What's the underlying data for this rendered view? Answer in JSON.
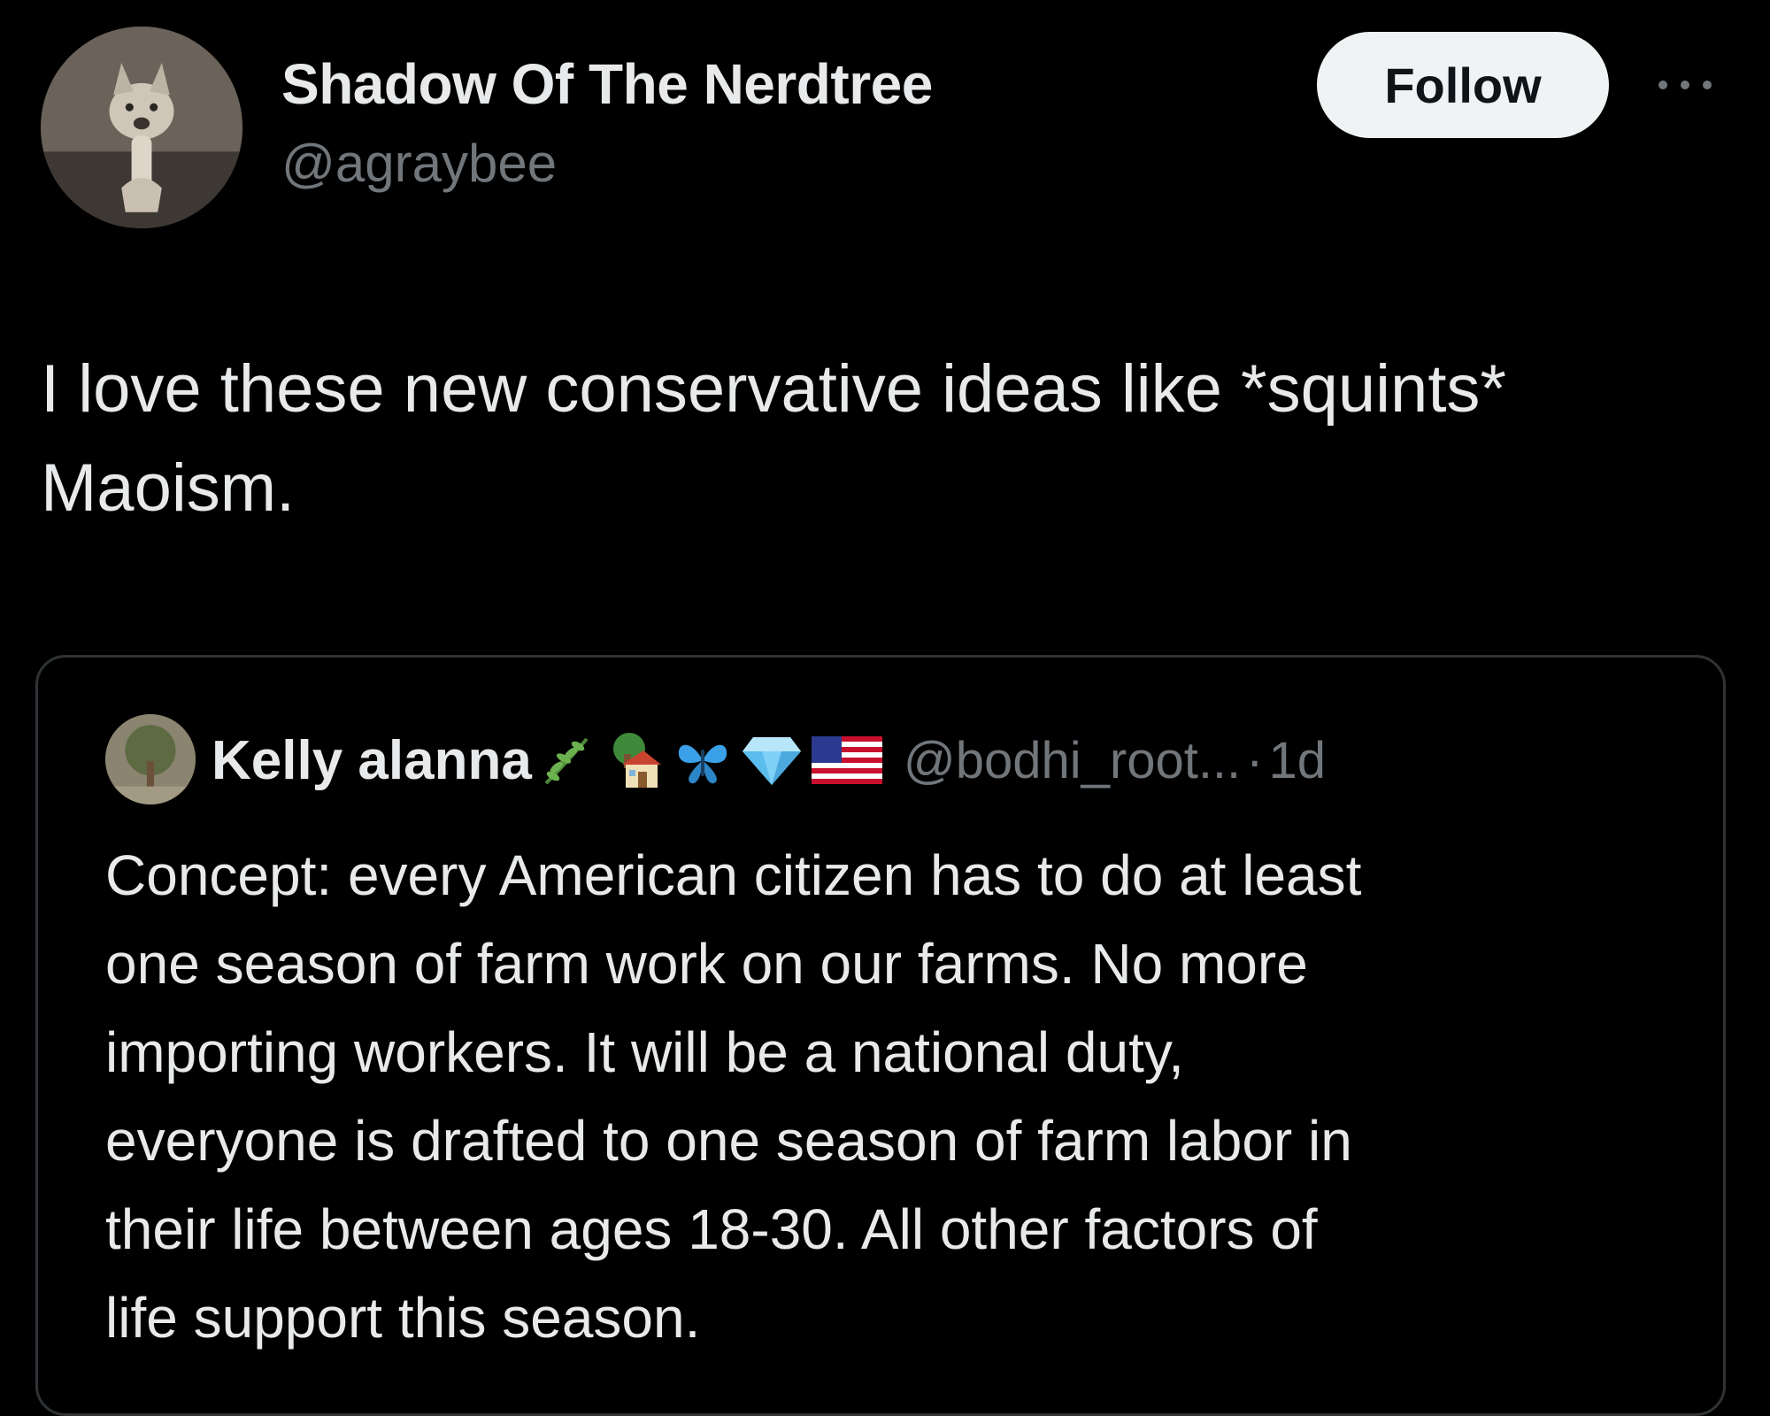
{
  "post": {
    "author": {
      "display_name": "Shadow Of The Nerdtree",
      "handle": "@agraybee",
      "avatar_icon": "fox-avatar"
    },
    "follow_label": "Follow",
    "more_icon": "more-dots-icon",
    "text_line1": "I love these new conservative ideas like *squints*",
    "text_line2": "Maoism."
  },
  "quote": {
    "author": {
      "display_name": "Kelly alanna",
      "emojis": [
        "herb-icon",
        "house-icon",
        "butterfly-icon",
        "diamond-icon",
        "us-flag-icon"
      ],
      "handle": "@bodhi_root...",
      "separator": "·",
      "time": "1d"
    },
    "text_lines": [
      "Concept: every American citizen has to do at least",
      "one season of farm work on our farms. No more",
      "importing workers. It will be a national duty,",
      "everyone is drafted to one season of farm labor in",
      "their life between ages 18-30. All other factors of",
      "life support this season."
    ]
  },
  "colors": {
    "background": "#000000",
    "text_primary": "#e7e9ea",
    "text_secondary": "#71767b",
    "border": "#2f3336",
    "follow_bg": "#eff3f4"
  }
}
